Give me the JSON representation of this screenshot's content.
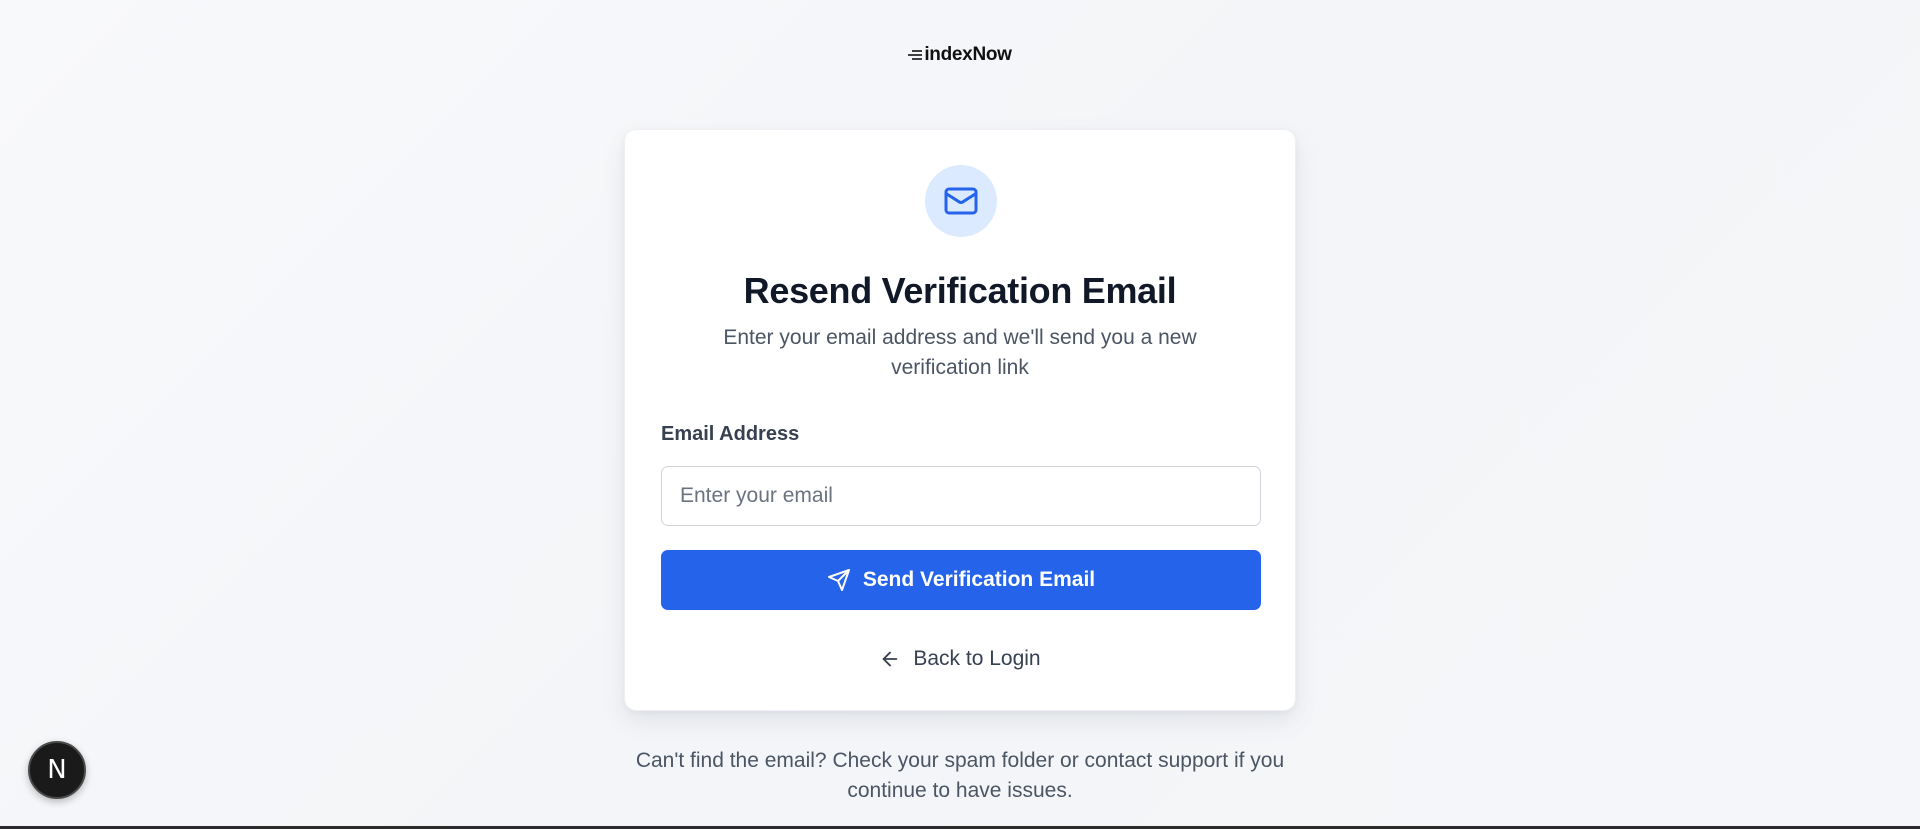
{
  "brand": {
    "logo_icon": "speed-lines-icon",
    "name": "indexNow"
  },
  "card": {
    "header_icon": "mail-icon",
    "title": "Resend Verification Email",
    "subtitle": "Enter your email address and we'll send you a new verification link",
    "email_label": "Email Address",
    "email_placeholder": "Enter your email",
    "email_value": "",
    "send_button_icon": "send-icon",
    "send_button_label": "Send Verification Email",
    "back_icon": "arrow-left-icon",
    "back_label": "Back to Login"
  },
  "help_text": "Can't find the email? Check your spam folder or contact support if you continue to have issues.",
  "dev_badge": {
    "icon": "next-logo-icon",
    "label": "N"
  },
  "colors": {
    "accent": "#2563eb",
    "icon_bg": "#dbeafe",
    "text_primary": "#111827",
    "text_secondary": "#4b5563"
  }
}
